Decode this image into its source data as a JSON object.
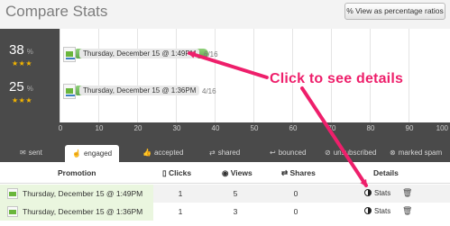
{
  "header": {
    "title": "Compare Stats",
    "view_button": "% View as percentage ratios",
    "view_button_icon": "percent-icon"
  },
  "chart": {
    "rows": [
      {
        "rank_value": "38",
        "unit": "%",
        "stars": "★★★",
        "label": "Thursday, December 15 @ 1:49PM",
        "fraction": "6/16",
        "value_fraction": 0.38
      },
      {
        "rank_value": "25",
        "unit": "%",
        "stars": "★★★",
        "label": "Thursday, December 15 @ 1:36PM",
        "fraction": "4/16",
        "value_fraction": 0.25
      }
    ],
    "x_ticks": [
      "0",
      "10",
      "20",
      "30",
      "40",
      "50",
      "60",
      "70",
      "80",
      "90",
      "100"
    ]
  },
  "tabs": [
    {
      "label": "sent",
      "icon": "envelope-icon",
      "active": false
    },
    {
      "label": "engaged",
      "icon": "finger-icon",
      "active": true
    },
    {
      "label": "accepted",
      "icon": "thumbs-up-icon",
      "active": false
    },
    {
      "label": "shared",
      "icon": "share-icon",
      "active": false
    },
    {
      "label": "bounced",
      "icon": "bounce-icon",
      "active": false
    },
    {
      "label": "unsubscribed",
      "icon": "unsubscribe-icon",
      "active": false
    },
    {
      "label": "marked spam",
      "icon": "spam-icon",
      "active": false
    }
  ],
  "table": {
    "columns": {
      "promotion": "Promotion",
      "clicks": "Clicks",
      "views": "Views",
      "shares": "Shares",
      "details": "Details"
    },
    "rows": [
      {
        "promotion": "Thursday, December 15 @ 1:49PM",
        "clicks": "1",
        "views": "5",
        "shares": "0",
        "details": "Stats"
      },
      {
        "promotion": "Thursday, December 15 @ 1:36PM",
        "clicks": "1",
        "views": "3",
        "shares": "0",
        "details": "Stats"
      }
    ]
  },
  "annotation": {
    "callout": "Click to see details",
    "color": "#ee1f6b"
  }
}
